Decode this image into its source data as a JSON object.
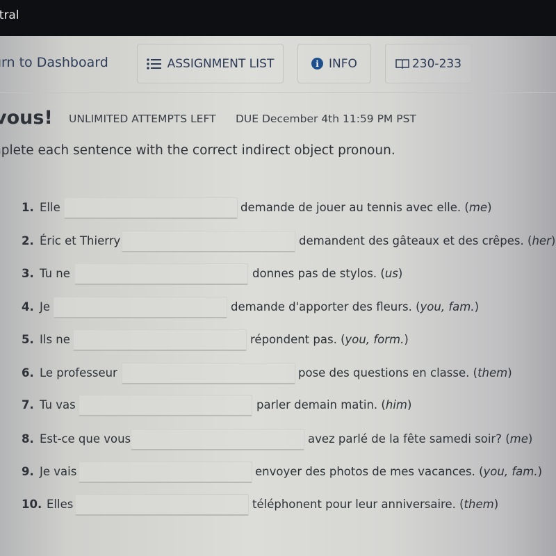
{
  "app": {
    "name": "ntral"
  },
  "nav": {
    "back_label": "urn to Dashboard",
    "assignment_list_label": "ASSIGNMENT LIST",
    "info_label": "INFO",
    "pages_label": "230-233"
  },
  "header": {
    "title": "vous!",
    "attempts": "UNLIMITED ATTEMPTS LEFT",
    "due": "DUE  December 4th 11:59 PM PST"
  },
  "instructions": "nplete each sentence with the correct indirect object pronoun.",
  "colors": {
    "accent": "#1f4e8c",
    "text": "#2c3b57"
  },
  "questions": [
    {
      "num": "1.",
      "before": "Elle",
      "value": "",
      "after": "demande de jouer au tennis avec elle.",
      "hint": "me"
    },
    {
      "num": "2.",
      "before": "Éric et Thierry",
      "value": "",
      "after": "demandent des gâteaux et des crêpes.",
      "hint": "her"
    },
    {
      "num": "3.",
      "before": "Tu ne",
      "value": "",
      "after": "donnes pas de stylos.",
      "hint": "us"
    },
    {
      "num": "4.",
      "before": "Je",
      "value": "",
      "after": "demande d'apporter des fleurs.",
      "hint": "you, fam."
    },
    {
      "num": "5.",
      "before": "Ils ne",
      "value": "",
      "after": "répondent pas.",
      "hint": "you, form."
    },
    {
      "num": "6.",
      "before": "Le professeur",
      "value": "",
      "after": "pose des questions en classe.",
      "hint": "them"
    },
    {
      "num": "7.",
      "before": "Tu vas",
      "value": "",
      "after": "parler demain matin.",
      "hint": "him"
    },
    {
      "num": "8.",
      "before": "Est-ce que vous",
      "value": "",
      "after": "avez parlé de la fête samedi soir?",
      "hint": "me"
    },
    {
      "num": "9.",
      "before": "Je vais",
      "value": "",
      "after": "envoyer des photos de mes vacances.",
      "hint": "you, fam."
    },
    {
      "num": "10.",
      "before": "Elles",
      "value": "",
      "after": "téléphonent pour leur anniversaire.",
      "hint": "them"
    }
  ]
}
